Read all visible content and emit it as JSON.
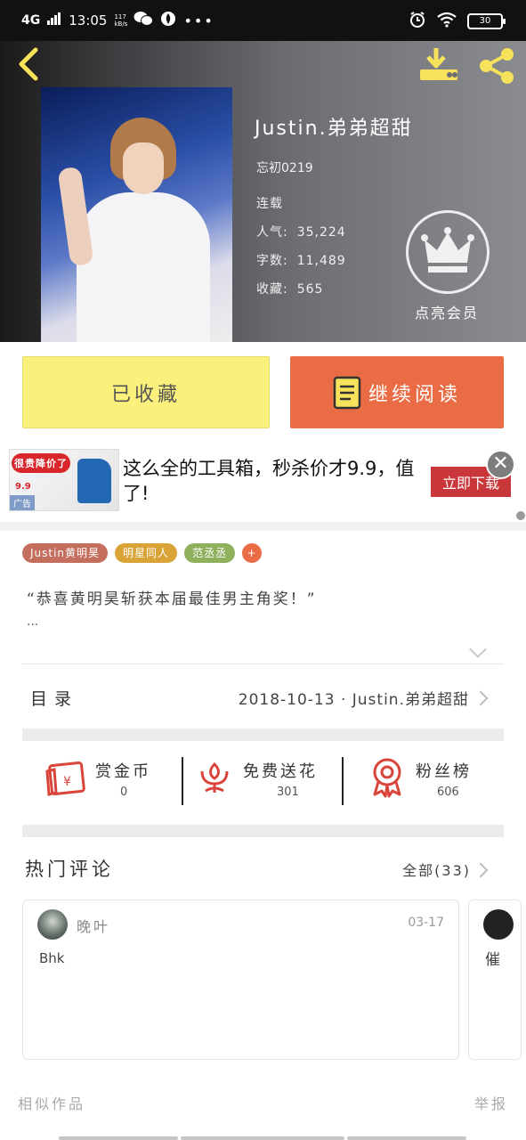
{
  "status_bar": {
    "network": "4G",
    "time": "13:05",
    "speed": "117 kB/s",
    "battery": "30"
  },
  "header": {
    "book_title": "Justin.弟弟超甜",
    "author": "忘初0219",
    "status": "连载",
    "popularity_label": "人气:",
    "popularity": "35,224",
    "word_count_label": "字数:",
    "word_count": "11,489",
    "favorites_label": "收藏:",
    "favorites": "565",
    "vip_label": "点亮会员"
  },
  "actions": {
    "collected_label": "已收藏",
    "continue_label": "继续阅读"
  },
  "ad": {
    "thumb_tag": "很贵降价了",
    "thumb_price": "9.9",
    "thumb_badge": "广告",
    "text": "这么全的工具箱，秒杀价才9.9，值了!",
    "cta": "立即下载"
  },
  "tags": [
    "Justin黄明昊",
    "明星同人",
    "范丞丞",
    "+"
  ],
  "intro": {
    "text": "“恭喜黄明昊斩获本届最佳男主角奖！”",
    "ellipsis": "..."
  },
  "toc": {
    "label": "目录",
    "info": "2018-10-13 · Justin.弟弟超甜"
  },
  "stats": [
    {
      "label": "赏金币",
      "count": "0",
      "icon": "red-envelope-icon"
    },
    {
      "label": "免费送花",
      "count": "301",
      "icon": "flower-icon"
    },
    {
      "label": "粉丝榜",
      "count": "606",
      "icon": "medal-icon"
    }
  ],
  "comments_section": {
    "title": "热门评论",
    "all_label": "全部(33)",
    "items": [
      {
        "name": "晚叶",
        "date": "03-17",
        "text": "Bhk"
      },
      {
        "text": "催"
      }
    ]
  },
  "footer": {
    "similar": "相似作品",
    "report": "举报"
  },
  "colors": {
    "accent_orange": "#ea6c45",
    "accent_yellow": "#fbf07b",
    "icon_yellow": "#f6e25b",
    "stat_red": "#d9453b"
  }
}
